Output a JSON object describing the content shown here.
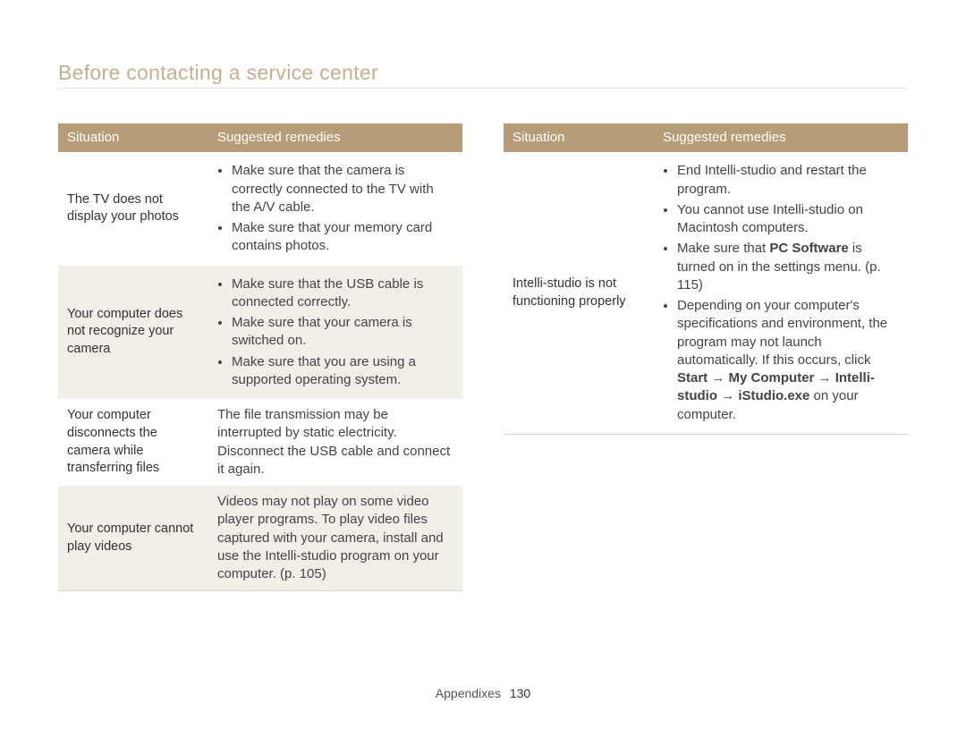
{
  "page_title": "Before contacting a service center",
  "header": {
    "situation": "Situation",
    "remedies": "Suggested remedies"
  },
  "left_rows": [
    {
      "situation": "The TV does not display your photos",
      "remedy_items": [
        [
          {
            "t": "Make sure that the camera is correctly connected to the TV with the A/V cable."
          }
        ],
        [
          {
            "t": "Make sure that your memory card contains photos."
          }
        ]
      ],
      "shaded": false,
      "bordered": false
    },
    {
      "situation": "Your computer does not recognize your camera",
      "remedy_items": [
        [
          {
            "t": "Make sure that the USB cable is connected correctly."
          }
        ],
        [
          {
            "t": "Make sure that your camera is switched on."
          }
        ],
        [
          {
            "t": "Make sure that you are using a supported operating system."
          }
        ]
      ],
      "shaded": true,
      "bordered": false
    },
    {
      "situation": "Your computer disconnects the camera while transferring files",
      "remedy_text": [
        {
          "t": "The file transmission may be interrupted by static electricity. Disconnect the USB cable and connect it again."
        }
      ],
      "shaded": false,
      "bordered": false
    },
    {
      "situation": "Your computer cannot play videos",
      "remedy_text": [
        {
          "t": "Videos may not play on some video player programs. To play video files captured with your camera, install and use the Intelli-studio program on your computer. (p. 105)"
        }
      ],
      "shaded": true,
      "bordered": true
    }
  ],
  "right_rows": [
    {
      "situation": "Intelli-studio is not functioning properly",
      "remedy_items": [
        [
          {
            "t": "End Intelli-studio and restart the program."
          }
        ],
        [
          {
            "t": "You cannot use Intelli-studio on Macintosh computers."
          }
        ],
        [
          {
            "t": "Make sure that "
          },
          {
            "t": "PC Software",
            "b": true
          },
          {
            "t": " is turned on in the settings menu. (p. 115)"
          }
        ],
        [
          {
            "t": "Depending on your computer's specifications and environment, the program may not launch automatically. If this occurs, click "
          },
          {
            "t": "Start",
            "b": true
          },
          {
            "t": " → "
          },
          {
            "t": "My Computer",
            "b": true
          },
          {
            "t": " → "
          },
          {
            "t": "Intelli-studio",
            "b": true
          },
          {
            "t": " → "
          },
          {
            "t": "iStudio.exe",
            "b": true
          },
          {
            "t": " on your computer."
          }
        ]
      ],
      "shaded": false,
      "bordered": true
    }
  ],
  "footer": {
    "section": "Appendixes",
    "page": "130"
  }
}
